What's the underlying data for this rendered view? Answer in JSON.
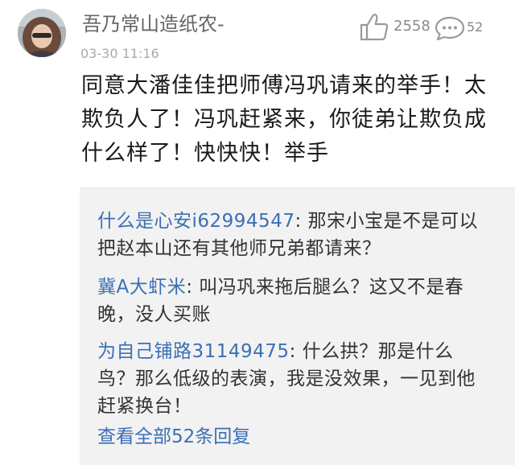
{
  "comment": {
    "username": "吾乃常山造纸农-",
    "timestamp": "03-30 11:16",
    "like_icon": "thumbs-up-icon",
    "like_count": "2558",
    "reply_icon": "speech-bubble-icon",
    "reply_count": "52",
    "text": "同意大潘佳佳把师傅冯巩请来的举手！太欺负人了！冯巩赶紧来，你徒弟让欺负成什么样了！快快快！举手"
  },
  "replies": [
    {
      "name": "什么是心安i62994547",
      "text": "那宋小宝是不是可以把赵本山还有其他师兄弟都请来？"
    },
    {
      "name": "冀A大虾米",
      "text": "叫冯巩来拖后腿么？这又不是春晚，没人买账"
    },
    {
      "name": "为自己铺路31149475",
      "text": "什么拱？那是什么鸟？那么低级的表演，我是没效果，一见到他赶紧换台！"
    }
  ],
  "view_all_label": "查看全部52条回复",
  "colors": {
    "link": "#3b6fb6",
    "reply_bg": "#f2f2f2",
    "meta": "#aaaaaa"
  }
}
